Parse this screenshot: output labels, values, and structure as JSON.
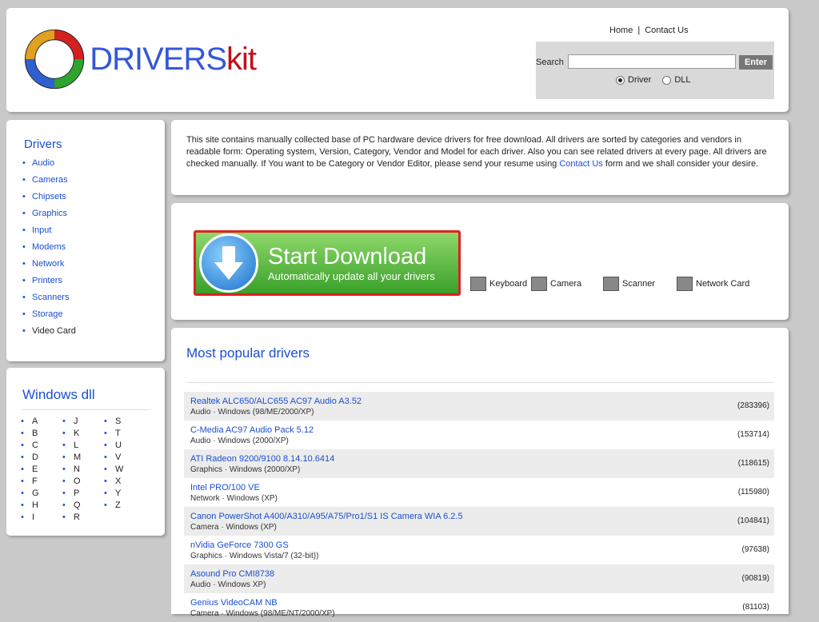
{
  "header": {
    "logo_text_a": "DRIVERS",
    "logo_text_b": "kit",
    "links": [
      "Home",
      "Contact Us"
    ],
    "search_label": "Search",
    "search_value": "",
    "enter_label": "Enter",
    "radio_driver": "Driver",
    "radio_dll": "DLL"
  },
  "sidebar": {
    "heading": "Drivers",
    "items": [
      "Audio",
      "Cameras",
      "Chipsets",
      "Graphics",
      "Input",
      "Modems",
      "Network",
      "Printers",
      "Scanners",
      "Storage",
      "Video Card"
    ],
    "dll_heading": "Windows dll",
    "letters": [
      "A",
      "J",
      "S",
      "B",
      "K",
      "T",
      "C",
      "L",
      "U",
      "D",
      "M",
      "V",
      "E",
      "N",
      "W",
      "F",
      "O",
      "X",
      "G",
      "P",
      "Y",
      "H",
      "Q",
      "Z",
      "I",
      "R",
      ""
    ]
  },
  "intro": {
    "text_before": "This site contains manually collected base of PC hardware device drivers for free download. All drivers are sorted by categories and vendors in readable form: Operating system, Version, Category, Vendor and Model for each driver. Also you can see related drivers at every page. All drivers are checked manually. If You want to be Category or Vendor Editor, please send your resume using ",
    "link": "Contact Us",
    "text_after": " form and we shall consider your desire."
  },
  "download": {
    "title": "Start Download",
    "subtitle": "Automatically update all your drivers"
  },
  "categories": [
    "Keyboard",
    "Camera",
    "Scanner",
    "Network Card"
  ],
  "popular": {
    "heading": "Most popular drivers",
    "rows": [
      {
        "name": "Realtek ALC650/ALC655 AC97 Audio A3.52",
        "desc": "Audio · Windows (98/ME/2000/XP)",
        "count": "(283396)"
      },
      {
        "name": "C-Media AC97 Audio Pack 5.12",
        "desc": "Audio · Windows (2000/XP)",
        "count": "(153714)"
      },
      {
        "name": "ATI Radeon 9200/9100 8.14.10.6414",
        "desc": "Graphics · Windows (2000/XP)",
        "count": "(118615)"
      },
      {
        "name": "Intel PRO/100 VE",
        "desc": "Network · Windows (XP)",
        "count": "(115980)"
      },
      {
        "name": "Canon PowerShot A400/A310/A95/A75/Pro1/S1 IS Camera WIA 6.2.5",
        "desc": "Camera · Windows (XP)",
        "count": "(104841)"
      },
      {
        "name": "nVidia GeForce 7300 GS",
        "desc": "Graphics · Windows Vista/7 (32-bit))",
        "count": "(97638)"
      },
      {
        "name": "Asound Pro CMI8738",
        "desc": "Audio · Windows XP)",
        "count": "(90819)"
      },
      {
        "name": "Genius VideoCAM NB",
        "desc": "Camera · Windows (98/ME/NT/2000/XP)",
        "count": "(81103)"
      }
    ]
  }
}
